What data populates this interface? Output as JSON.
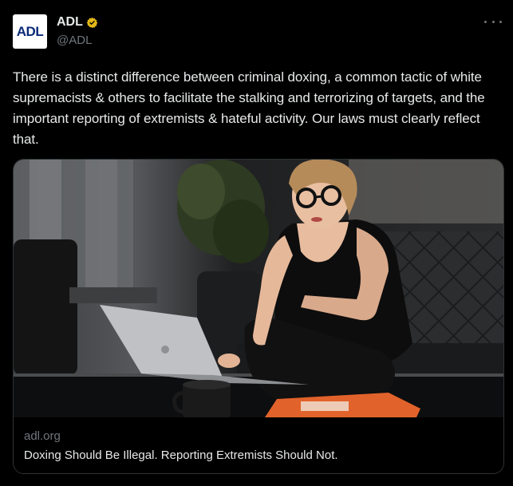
{
  "author": {
    "avatar_text": "ADL",
    "display_name": "ADL",
    "handle": "@ADL",
    "verified_color": "#e2b719"
  },
  "tweet": {
    "text": "There is a distinct difference between criminal doxing, a common tactic of white supremacists & others to facilitate the stalking and terrorizing of targets, and the important reporting of extremists & hateful activity. Our laws must clearly reflect that."
  },
  "link_card": {
    "domain": "adl.org",
    "title": "Doxing Should Be Illegal. Reporting Extremists Should Not."
  },
  "icons": {
    "verified": "verified-badge-icon",
    "more": "more-options-icon"
  }
}
